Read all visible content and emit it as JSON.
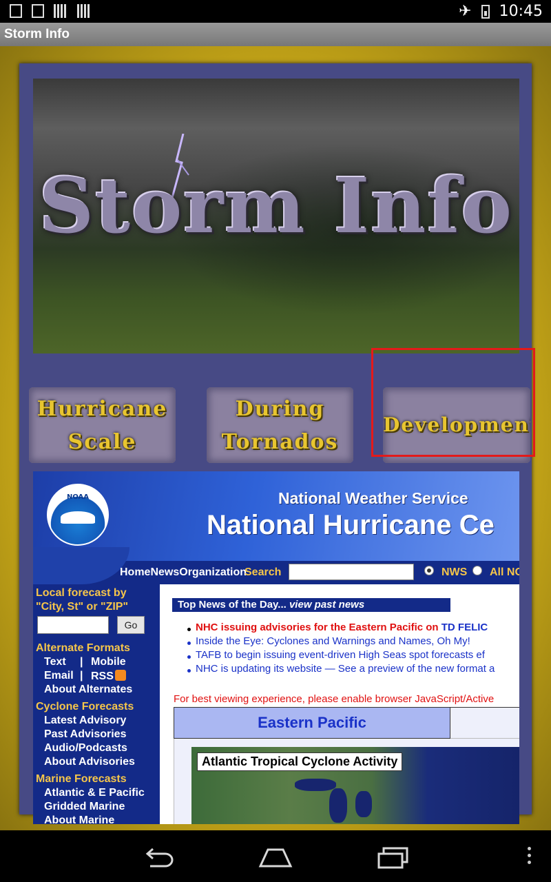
{
  "status_bar": {
    "time": "10:45",
    "notification_icons": [
      "download-icon",
      "image-icon",
      "barcode-icon",
      "barcode-icon"
    ],
    "system_icons": [
      "airplane-mode-icon",
      "battery-charging-icon"
    ]
  },
  "app": {
    "title": "Storm Info"
  },
  "hero": {
    "title": "Storm Info"
  },
  "nav_buttons": [
    {
      "line1": "Hurricane",
      "line2": "Scale"
    },
    {
      "line1": "During",
      "line2": "Tornados"
    },
    {
      "line1": "Developments",
      "line2": ""
    }
  ],
  "nhc_page": {
    "agency": "National Weather Service",
    "center_title": "National Hurricane Ce",
    "logo_text": "NOAA",
    "nav_links": "HomeNewsOrganization",
    "search_label": "Search",
    "radio_nws": "NWS",
    "radio_all": "All NO",
    "sidebar": {
      "local_forecast_line1": "Local forecast by",
      "local_forecast_line2": "\"City, St\" or \"ZIP\"",
      "go_button": "Go",
      "alternate_formats": "Alternate Formats",
      "text": "Text",
      "separator": "|",
      "mobile": "Mobile",
      "email": "Email",
      "rss": "RSS",
      "about_alternates": "About Alternates",
      "cyclone_forecasts": "Cyclone Forecasts",
      "latest_advisory": "Latest Advisory",
      "past_advisories": "Past Advisories",
      "audio_podcasts": "Audio/Podcasts",
      "about_advisories": "About Advisories",
      "marine_forecasts": "Marine Forecasts",
      "atlantic_epacific": "Atlantic & E Pacific",
      "gridded_marine": "Gridded Marine",
      "about_marine": "About Marine"
    },
    "top_news_label": "Top News of the Day...",
    "view_past_news": "view past news",
    "news_items": [
      {
        "prefix": "NHC issuing advisories for the Eastern Pacific on ",
        "link": "TD FELIC"
      },
      {
        "text": "Inside the Eye: Cyclones and Warnings and Names, Oh My!"
      },
      {
        "text": "TAFB to begin issuing event-driven High Seas spot forecasts ef"
      },
      {
        "text": "NHC is updating its website — See a preview of the new format a"
      }
    ],
    "warning": "For best viewing experience, please enable browser JavaScript/Active",
    "tab_eastern_pacific": "Eastern Pacific",
    "map_title": "Atlantic Tropical Cyclone Activity"
  },
  "colors": {
    "frame_gold": "#d4b21a",
    "panel_purple": "#474a85",
    "button_text_gold": "#e8c530",
    "nhc_blue": "#132a88",
    "highlight_red": "#e31a1a"
  },
  "navigation_bar": {
    "buttons": [
      "back-icon",
      "home-icon",
      "recent-apps-icon",
      "menu-icon"
    ]
  }
}
